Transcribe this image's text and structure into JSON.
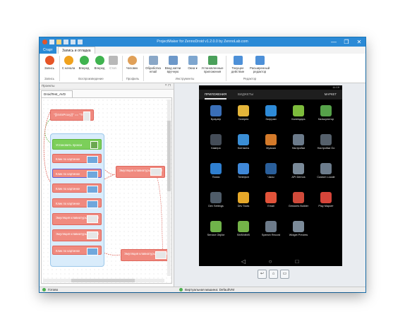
{
  "app": {
    "title": "ProjectMaker for ZennoDroid v1.2.0.0 by ZennoLab.com",
    "window_buttons": [
      "—",
      "❐",
      "✕"
    ]
  },
  "ribbon": {
    "tabs": [
      "Старт",
      "Запись и отладка"
    ],
    "groups": [
      {
        "label": "Запись",
        "buttons": [
          {
            "label": "Запись",
            "icon": "record-icon",
            "color": "#e65527"
          }
        ]
      },
      {
        "label": "Воспроизведение",
        "buttons": [
          {
            "label": "С начала",
            "icon": "restart-icon",
            "color": "#f0a21d"
          },
          {
            "label": "Вперед",
            "icon": "play-icon",
            "color": "#3fb34f"
          },
          {
            "label": "Вперед",
            "icon": "step-icon",
            "color": "#3fb34f"
          },
          {
            "label": "Стоп",
            "icon": "stop-icon",
            "color": "#b9b9b9"
          }
        ]
      },
      {
        "label": "Профиль",
        "buttons": [
          {
            "label": "Человек",
            "icon": "person-icon",
            "color": "#e0a058"
          }
        ]
      },
      {
        "label": "Инструменты",
        "buttons": [
          {
            "label": "Обработка email",
            "icon": "email-icon",
            "color": "#8aa7c7"
          },
          {
            "label": "Ввод капчи вручную",
            "icon": "captcha-icon",
            "color": "#6d98c9"
          },
          {
            "label": "Окна ▾",
            "icon": "windows-icon",
            "color": "#7ea6cf"
          },
          {
            "label": "Установленные приложения",
            "icon": "apps-icon",
            "color": "#4aa05a"
          }
        ]
      },
      {
        "label": "Редактор",
        "buttons": [
          {
            "label": "Текущее действие",
            "icon": "current-action-icon",
            "color": "#4d90d8"
          },
          {
            "label": "Расширенный редактор",
            "icon": "editor-icon",
            "color": "#4d90d8"
          }
        ]
      }
    ]
  },
  "left_panel": {
    "header": "Проекты",
    "tab_label": "DroidTest_AVD",
    "nodes": [
      {
        "label": "\"{{isVisProxy}}\" == \"True\"",
        "style": "red"
      },
      {
        "label": "Установить прокси",
        "style": "green"
      },
      {
        "label": "Клик по картинке",
        "style": "red"
      },
      {
        "label": "Клик по картинке",
        "style": "red"
      },
      {
        "label": "Клик по картинке",
        "style": "red"
      },
      {
        "label": "Клик по картинке",
        "style": "red"
      },
      {
        "label": "Эмуляция клавиатуры Android",
        "style": "red"
      },
      {
        "label": "Эмуляция клавиатуры Android",
        "style": "red"
      },
      {
        "label": "Клик по картинке",
        "style": "red"
      },
      {
        "label": "Эмуляция клавиатуры Android",
        "style": "red"
      },
      {
        "label": "Эмуляция клавиатуры Android",
        "style": "red"
      }
    ]
  },
  "phone": {
    "time": "11:19",
    "tabs": [
      "ПРИЛОЖЕНИЯ",
      "ВИДЖЕТЫ",
      "МАРКЕТ"
    ],
    "apps": [
      {
        "label": "Браузер",
        "color": "#3a6fb8"
      },
      {
        "label": "Галерея",
        "color": "#e4b53a"
      },
      {
        "label": "Загрузки",
        "color": "#2e8bd8"
      },
      {
        "label": "Календарь",
        "color": "#7dbb3c"
      },
      {
        "label": "Калькулятор",
        "color": "#56a24a"
      },
      {
        "label": "Камера",
        "color": "#444c57"
      },
      {
        "label": "Контакты",
        "color": "#3a8ed6"
      },
      {
        "label": "Музыка",
        "color": "#d47a2a"
      },
      {
        "label": "Настройки",
        "color": "#6b7a8a"
      },
      {
        "label": "Настройки Go",
        "color": "#55606b"
      },
      {
        "label": "Поиск",
        "color": "#2f7fd0"
      },
      {
        "label": "Телефон",
        "color": "#3f88d8"
      },
      {
        "label": "Часы",
        "color": "#2a5f9b"
      },
      {
        "label": "API Demos",
        "color": "#7a8a99"
      },
      {
        "label": "Custom Locale",
        "color": "#6c7c8c"
      },
      {
        "label": "Dev Settings",
        "color": "#4f5c69"
      },
      {
        "label": "Dev Tools",
        "color": "#e6a829"
      },
      {
        "label": "Email",
        "color": "#e2533a"
      },
      {
        "label": "Gestures Builder",
        "color": "#d04a3a"
      },
      {
        "label": "Play Маркет",
        "color": "#d6453a"
      },
      {
        "label": "Service Obj/ke",
        "color": "#6fb34a"
      },
      {
        "label": "SMS/MMS",
        "color": "#74b348"
      },
      {
        "label": "Speech Record",
        "color": "#6d7b8a"
      },
      {
        "label": "Widget Preview",
        "color": "#7c8b99"
      }
    ],
    "nav": [
      "◁",
      "○",
      "□"
    ]
  },
  "controls": [
    "↩",
    "⌂",
    "▭"
  ],
  "status": {
    "text": "Готово",
    "vm": "Виртуальная машина: DefaultVM"
  }
}
